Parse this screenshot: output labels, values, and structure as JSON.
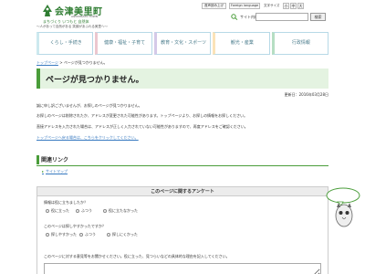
{
  "header": {
    "site_name": "会津美里町",
    "site_name_roman": "AIZUMISATO TOWN",
    "tagline": "まちづくり いつもと 自然体",
    "tagline2": "～人があって自然がある 笑顔があふれる美里へ～",
    "voice_reading_label": "音声読み上げ",
    "foreign_language_label": "Foreign language",
    "font_size_label": "文字サイズ",
    "font_size_small": "小",
    "font_size_medium": "中",
    "font_size_large": "大",
    "site_search_label": "サイト内検索",
    "search_button_label": "検索"
  },
  "nav": {
    "items": [
      {
        "label": "くらし・手続き"
      },
      {
        "label": "健康・福祉・子育て"
      },
      {
        "label": "教育・文化・スポーツ"
      },
      {
        "label": "観光・産業"
      },
      {
        "label": "行政情報"
      }
    ]
  },
  "breadcrumb": {
    "home_label": "トップページ",
    "separator": " > ",
    "current_label": "ページが見つかりません。"
  },
  "main": {
    "title": "ページが見つかりません。",
    "update_label": "更新日：2016年03月28日",
    "lines": [
      "誠に申し訳ございませんが、お探しのページが見つかりません。",
      "お探しのページは削除されたか、アドレスが変更された可能性があります。トップページより、お探しの情報をお探しください。",
      "直接アドレスを入力された場合は、アドレスが正しく入力されていない可能性がありますので、再度アドレスをご確認ください。"
    ],
    "top_link_label": "トップページへ戻る場合は、こちらをクリックしてください。"
  },
  "related": {
    "title": "関連リンク",
    "links": [
      {
        "label": "サイトマップ"
      }
    ]
  },
  "survey": {
    "title": "このページに関するアンケート",
    "q1": "情報は役に立ちましたか？",
    "q1_options": [
      "役に立った",
      "ふつう",
      "役に立たなかった"
    ],
    "q2": "このページは探しやすかったですか？",
    "q2_options": [
      "探しやすかった",
      "ふつう",
      "探しにくかった"
    ],
    "q3": "このページに対する意見等をお聞かせください。役に立った、見つらいなどの具体的な理由を記入してください。"
  },
  "colors": {
    "brand_green": "#4a9d3a",
    "title_bg": "#e4f3e1",
    "link_blue": "#3a7bc1",
    "nav_text": "#4a7c8c"
  }
}
